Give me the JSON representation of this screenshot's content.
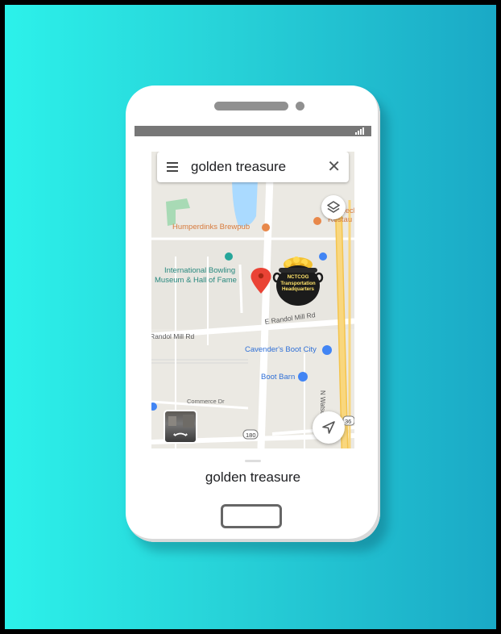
{
  "search": {
    "query": "golden treasure",
    "close_symbol": "✕"
  },
  "map": {
    "labels": {
      "humperdinks": "Humperdinks Brewpub",
      "redneck": "Redneck",
      "restau": "Restau",
      "bowling_line1": "International Bowling",
      "bowling_line2": "Museum & Hall of Fame",
      "randol_w": "Randol Mill Rd",
      "randol_e": "E Randol Mill Rd",
      "cavenders": "Cavender's Boot City",
      "boot_barn": "Boot Barn",
      "watson": "N Watson Rd",
      "commerce": "Commerce Dr",
      "route_180": "180",
      "route_36": "36"
    },
    "marker": {
      "line1": "NCTCOG",
      "line2": "Transportation",
      "line3": "Headquarters"
    }
  },
  "bottom_sheet": {
    "title": "golden treasure"
  },
  "colors": {
    "background_left": "#2cf1ea",
    "background_right": "#1aa9c6",
    "pin_red": "#ea4335",
    "poi_blue": "#4285f4",
    "food_orange": "#e8884a",
    "park_green": "#a8dab5",
    "water_blue": "#aadaff",
    "highway_yellow": "#f9d77e"
  }
}
